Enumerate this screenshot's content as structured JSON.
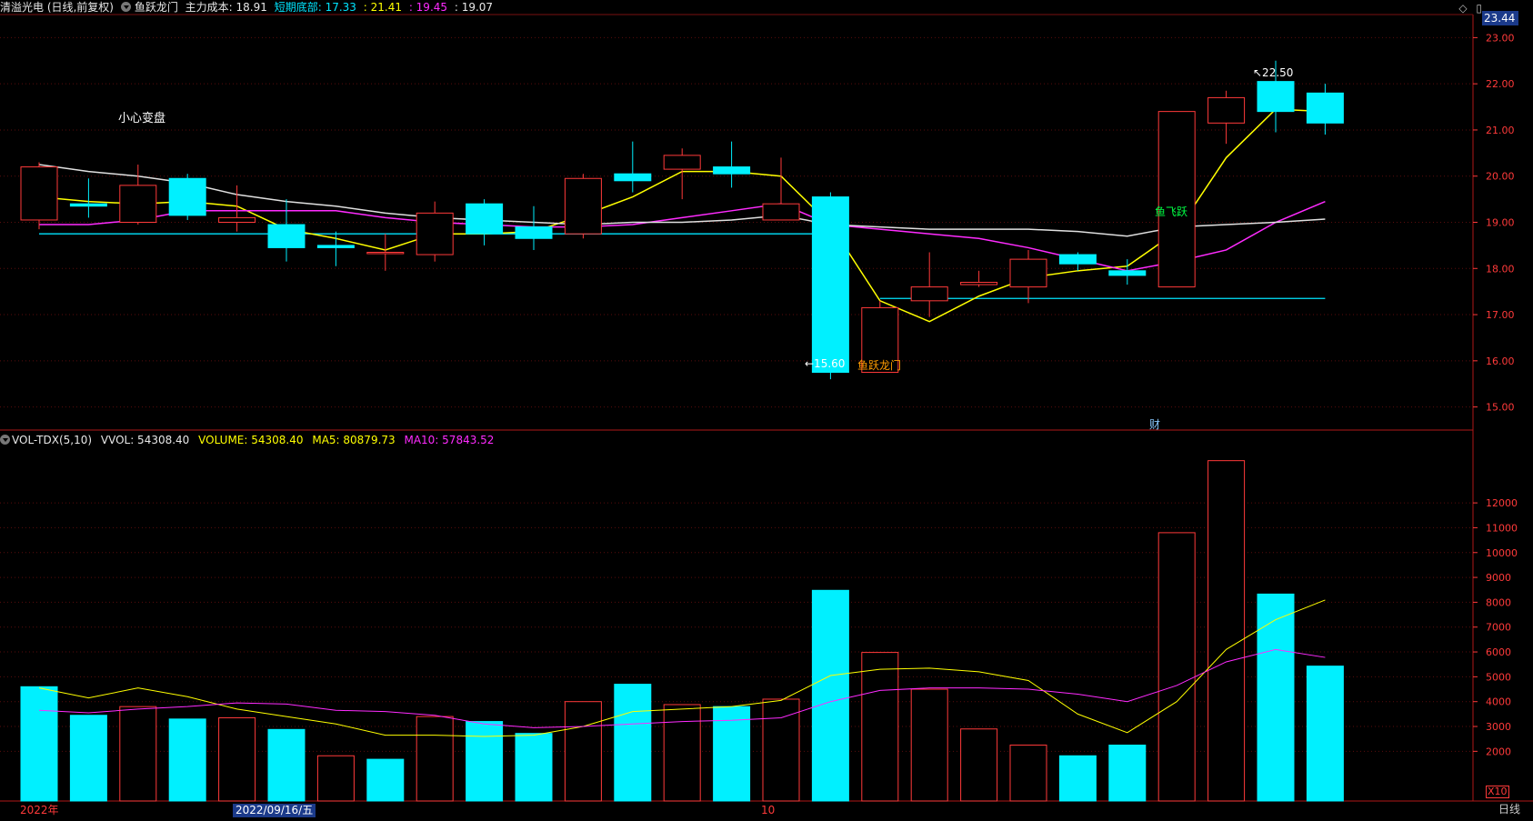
{
  "header": {
    "stock": "清溢光电 (日线,前复权)",
    "indicator": "鱼跃龙门",
    "cost_label": "主力成本: 18.91",
    "bottom_label": "短期底部: 17.33",
    "v1": ": 21.41",
    "v2": ": 19.45",
    "v3": ": 19.07",
    "colors": {
      "white": "#e0e0e0",
      "cyan": "#00e5ff",
      "yellow": "#ffff00",
      "magenta": "#ff2bff"
    }
  },
  "last_price_box": "23.44",
  "volume_header": {
    "title": "VOL-TDX(5,10)",
    "vvol": "VVOL: 54308.40",
    "volume": "VOLUME: 54308.40",
    "ma5": "MA5: 80879.73",
    "ma10": "MA10: 57843.52"
  },
  "annotations": {
    "careful": "小心变盘",
    "high": "22.50",
    "low": "15.60",
    "fish_gate": "鱼跃龙门",
    "fish_jump": "鱼飞跃",
    "cai": "财"
  },
  "bottom_bar": {
    "year": "2022年",
    "date": "2022/09/16/五",
    "month": "10",
    "period": "日线",
    "x10": "X10"
  },
  "chart_data": [
    {
      "type": "candlestick",
      "title": "清溢光电 (日线,前复权)",
      "ylim": [
        14.5,
        23.5
      ],
      "yticks": [
        "23.00",
        "22.00",
        "21.00",
        "20.00",
        "19.00",
        "18.00",
        "17.00",
        "16.00",
        "15.00"
      ],
      "candles": [
        {
          "o": 19.05,
          "h": 20.3,
          "l": 18.85,
          "c": 20.2
        },
        {
          "o": 19.4,
          "h": 19.95,
          "l": 19.1,
          "c": 19.35
        },
        {
          "o": 19.0,
          "h": 20.25,
          "l": 18.95,
          "c": 19.8
        },
        {
          "o": 19.95,
          "h": 20.05,
          "l": 19.05,
          "c": 19.15
        },
        {
          "o": 19.0,
          "h": 19.8,
          "l": 18.8,
          "c": 19.1
        },
        {
          "o": 18.95,
          "h": 19.5,
          "l": 18.15,
          "c": 18.45
        },
        {
          "o": 18.5,
          "h": 18.8,
          "l": 18.05,
          "c": 18.45
        },
        {
          "o": 18.35,
          "h": 18.75,
          "l": 17.95,
          "c": 18.35
        },
        {
          "o": 18.3,
          "h": 19.45,
          "l": 18.15,
          "c": 19.2
        },
        {
          "o": 19.4,
          "h": 19.5,
          "l": 18.5,
          "c": 18.75
        },
        {
          "o": 18.9,
          "h": 19.35,
          "l": 18.4,
          "c": 18.65
        },
        {
          "o": 18.75,
          "h": 20.05,
          "l": 18.65,
          "c": 19.95
        },
        {
          "o": 20.05,
          "h": 20.75,
          "l": 19.65,
          "c": 19.9
        },
        {
          "o": 20.15,
          "h": 20.6,
          "l": 19.5,
          "c": 20.45
        },
        {
          "o": 20.2,
          "h": 20.75,
          "l": 19.75,
          "c": 20.05
        },
        {
          "o": 19.05,
          "h": 20.4,
          "l": 19.05,
          "c": 19.4
        },
        {
          "o": 19.55,
          "h": 19.65,
          "l": 15.6,
          "c": 15.75
        },
        {
          "o": 15.75,
          "h": 17.3,
          "l": 15.75,
          "c": 17.15
        },
        {
          "o": 17.3,
          "h": 18.35,
          "l": 16.95,
          "c": 17.6
        },
        {
          "o": 17.65,
          "h": 17.95,
          "l": 17.6,
          "c": 17.7
        },
        {
          "o": 17.6,
          "h": 18.4,
          "l": 17.25,
          "c": 18.2
        },
        {
          "o": 18.3,
          "h": 18.35,
          "l": 17.95,
          "c": 18.1
        },
        {
          "o": 17.95,
          "h": 18.2,
          "l": 17.65,
          "c": 17.85
        },
        {
          "o": 17.6,
          "h": 21.4,
          "l": 17.6,
          "c": 21.4
        },
        {
          "o": 21.15,
          "h": 21.85,
          "l": 20.7,
          "c": 21.7
        },
        {
          "o": 22.05,
          "h": 22.5,
          "l": 20.95,
          "c": 21.4
        },
        {
          "o": 21.8,
          "h": 22.0,
          "l": 20.9,
          "c": 21.15
        }
      ],
      "series": [
        {
          "color": "#ffff00",
          "values": [
            19.55,
            19.45,
            19.4,
            19.45,
            19.35,
            18.85,
            18.65,
            18.4,
            18.75,
            18.75,
            18.8,
            19.15,
            19.55,
            20.1,
            20.1,
            20.0,
            18.95,
            17.3,
            16.85,
            17.4,
            17.8,
            17.95,
            18.05,
            18.8,
            20.4,
            21.45,
            21.4
          ]
        },
        {
          "color": "#ff2bff",
          "values": [
            18.95,
            18.95,
            19.05,
            19.25,
            19.25,
            19.25,
            19.25,
            19.1,
            19.0,
            18.95,
            18.9,
            18.9,
            18.95,
            19.1,
            19.25,
            19.4,
            18.95,
            18.85,
            18.75,
            18.65,
            18.45,
            18.2,
            17.95,
            18.15,
            18.4,
            19.0,
            19.45
          ]
        },
        {
          "color": "#e0e0e0",
          "values": [
            20.25,
            20.1,
            20.0,
            19.85,
            19.6,
            19.45,
            19.35,
            19.2,
            19.1,
            19.05,
            19.0,
            18.95,
            19.0,
            19.0,
            19.05,
            19.15,
            18.95,
            18.9,
            18.85,
            18.85,
            18.85,
            18.8,
            18.7,
            18.9,
            18.95,
            19.0,
            19.07
          ]
        }
      ],
      "support_lines": [
        {
          "color": "#00e5ff",
          "from": 0,
          "to": 16,
          "value": 18.75
        },
        {
          "color": "#00e5ff",
          "from": 17,
          "to": 26,
          "value": 17.35
        }
      ]
    },
    {
      "type": "bar",
      "title": "VOL-TDX(5,10)",
      "ylim": [
        0,
        14200
      ],
      "yticks": [
        "12000",
        "11000",
        "10000",
        "9000",
        "8000",
        "7000",
        "6000",
        "5000",
        "4000",
        "3000",
        "2000"
      ],
      "volumes": [
        4600,
        3450,
        3800,
        3300,
        3350,
        2880,
        1820,
        1680,
        3400,
        3200,
        2720,
        4000,
        4700,
        3880,
        3800,
        4100,
        8480,
        5980,
        4500,
        2900,
        2250,
        1820,
        2250,
        10800,
        13700,
        8330,
        5430
      ],
      "up": [
        false,
        false,
        true,
        false,
        true,
        false,
        true,
        false,
        true,
        false,
        false,
        true,
        false,
        true,
        false,
        true,
        false,
        true,
        true,
        true,
        true,
        false,
        false,
        true,
        true,
        false,
        false
      ],
      "series": [
        {
          "color": "#ffff00",
          "values": [
            4550,
            4150,
            4550,
            4200,
            3700,
            3400,
            3100,
            2650,
            2650,
            2600,
            2650,
            3000,
            3600,
            3700,
            3800,
            4050,
            5050,
            5300,
            5350,
            5200,
            4850,
            3500,
            2750,
            4000,
            6100,
            7300,
            8090
          ]
        },
        {
          "color": "#ff2bff",
          "values": [
            3650,
            3550,
            3700,
            3800,
            3950,
            3900,
            3650,
            3600,
            3450,
            3100,
            2950,
            3000,
            3100,
            3200,
            3250,
            3350,
            4000,
            4450,
            4550,
            4550,
            4500,
            4300,
            4000,
            4650,
            5600,
            6100,
            5780
          ]
        }
      ]
    }
  ]
}
